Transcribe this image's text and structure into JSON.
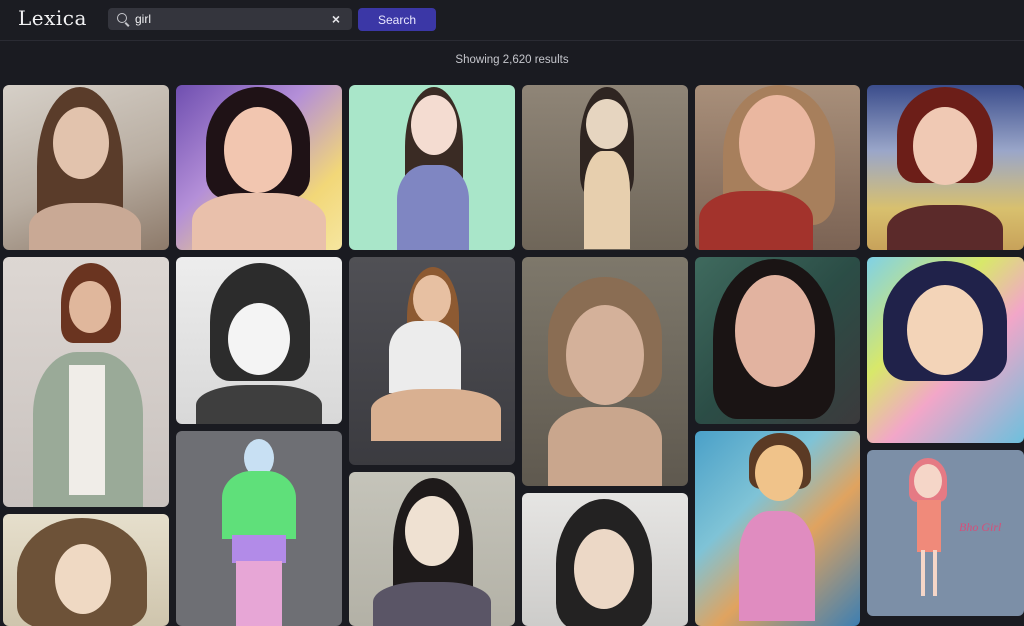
{
  "app": {
    "logo": "Lexica"
  },
  "search": {
    "value": "girl",
    "placeholder": "Search",
    "clear_label": "×",
    "button_label": "Search"
  },
  "results": {
    "label": "Showing 2,620 results"
  },
  "gallery": {
    "handwritten_caption": "Bho Girl"
  },
  "colors": {
    "accent": "#3b37a6",
    "background": "#1a1b21",
    "topbar": "#1b1c22"
  }
}
